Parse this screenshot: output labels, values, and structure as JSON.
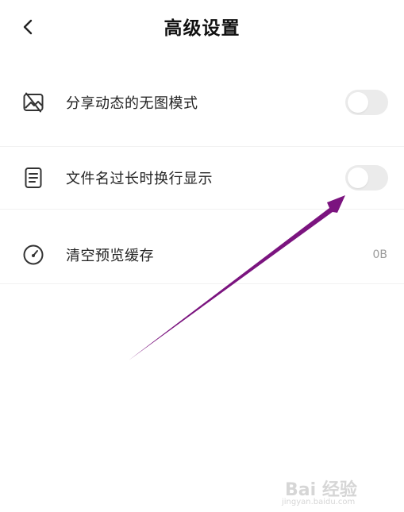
{
  "header": {
    "title": "高级设置",
    "back_icon": "chevron-left-icon"
  },
  "settings": [
    {
      "label": "分享动态的无图模式",
      "icon": "no-image-icon",
      "control": "toggle",
      "enabled": false
    },
    {
      "label": "文件名过长时换行显示",
      "icon": "document-icon",
      "control": "toggle",
      "enabled": false
    },
    {
      "label": "清空预览缓存",
      "icon": "gauge-icon",
      "control": "value",
      "value": "0B"
    }
  ],
  "annotation": {
    "arrow_color": "#7b147f"
  },
  "watermark": {
    "main": "Bai  经验",
    "sub": "jingyan.baidu.com"
  }
}
